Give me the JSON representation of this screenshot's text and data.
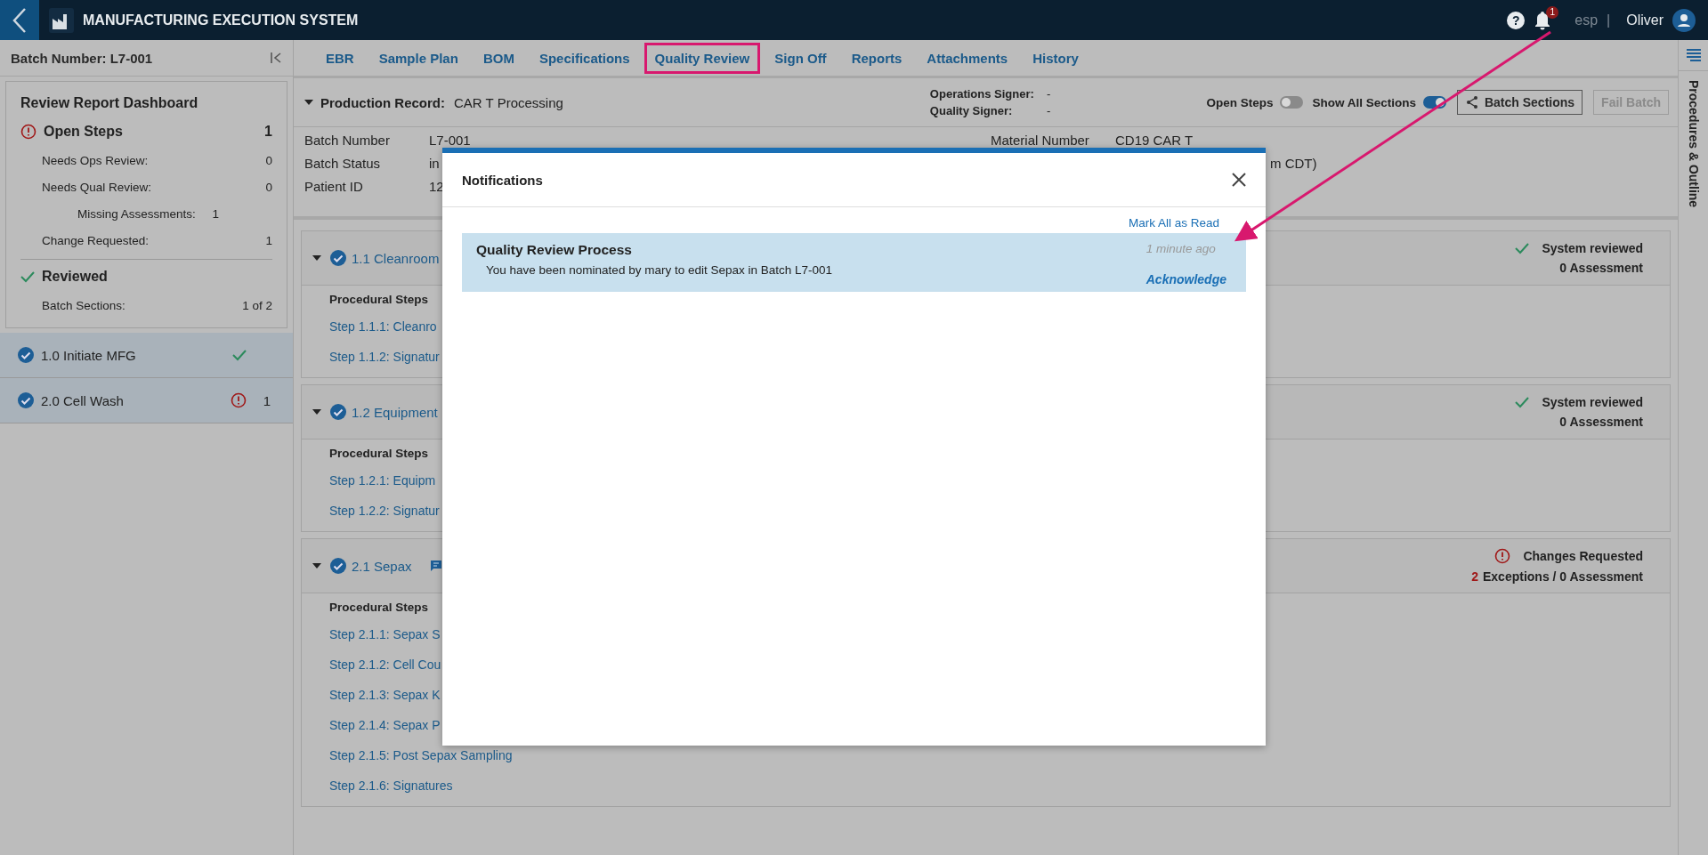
{
  "header": {
    "title": "MANUFACTURING EXECUTION SYSTEM",
    "help": "?",
    "notifications_badge": "1",
    "language": "esp",
    "separator": "|",
    "user": "Oliver"
  },
  "sidebar": {
    "batch_title": "Batch Number: L7-001",
    "dashboard": {
      "title": "Review Report Dashboard",
      "open_steps": {
        "label": "Open Steps",
        "value": "1"
      },
      "open_rows": [
        {
          "label": "Needs Ops Review:",
          "value": "0",
          "indented": false
        },
        {
          "label": "Needs Qual Review:",
          "value": "0",
          "indented": false
        },
        {
          "label": "Missing Assessments:",
          "value": "1",
          "indented": true
        },
        {
          "label": "Change Requested:",
          "value": "1",
          "indented": false
        }
      ],
      "reviewed": {
        "label": "Reviewed"
      },
      "reviewed_rows": [
        {
          "label": "Batch Sections:",
          "value": "1 of 2"
        }
      ]
    },
    "items": [
      {
        "label": "1.0 Initiate MFG",
        "kind": "ok"
      },
      {
        "label": "2.0 Cell Wash",
        "kind": "alert",
        "count": "1"
      }
    ]
  },
  "tabs": [
    {
      "label": "EBR",
      "selected": false
    },
    {
      "label": "Sample Plan",
      "selected": false
    },
    {
      "label": "BOM",
      "selected": false
    },
    {
      "label": "Specifications",
      "selected": false
    },
    {
      "label": "Quality Review",
      "selected": true
    },
    {
      "label": "Sign Off",
      "selected": false
    },
    {
      "label": "Reports",
      "selected": false
    },
    {
      "label": "Attachments",
      "selected": false
    },
    {
      "label": "History",
      "selected": false
    }
  ],
  "record": {
    "label": "Production Record:",
    "value": "CAR T Processing",
    "signers": [
      {
        "label": "Operations Signer:",
        "value": "-"
      },
      {
        "label": "Quality Signer:",
        "value": "-"
      }
    ],
    "toggles": [
      {
        "label": "Open Steps",
        "on": false
      },
      {
        "label": "Show All Sections",
        "on": true
      }
    ],
    "buttons": [
      {
        "label": "Batch Sections",
        "disabled": false
      },
      {
        "label": "Fail Batch",
        "disabled": true
      }
    ]
  },
  "info": [
    {
      "label": "Batch Number",
      "value": "L7-001",
      "right_label": "Material Number",
      "right_value": "CD19 CAR T"
    },
    {
      "label": "Batch Status",
      "value": "in",
      "right_value": "m CDT)"
    },
    {
      "label": "Patient ID",
      "value": "12"
    }
  ],
  "sections": [
    {
      "title": "1.1 Cleanroom",
      "kind": "reviewed",
      "status_text": "System reviewed",
      "assessment": "0 Assessment",
      "steps_title": "Procedural Steps",
      "steps": [
        "Step 1.1.1: Cleanro",
        "Step 1.1.2: Signatur"
      ]
    },
    {
      "title": "1.2 Equipment",
      "kind": "reviewed",
      "status_text": "System reviewed",
      "assessment": "0 Assessment",
      "steps_title": "Procedural Steps",
      "steps": [
        "Step 1.2.1: Equipm",
        "Step 1.2.2: Signatur"
      ]
    },
    {
      "title": "2.1 Sepax",
      "comment": true,
      "kind": "changes",
      "status_text": "Changes Requested",
      "exceptions": "2",
      "assessment": "Exceptions / 0 Assessment",
      "steps_title": "Procedural Steps",
      "steps": [
        "Step 2.1.1: Sepax S",
        "Step 2.1.2: Cell Cou",
        "Step 2.1.3: Sepax K",
        "Step 2.1.4: Sepax P",
        "Step 2.1.5: Post Sepax Sampling",
        "Step 2.1.6: Signatures"
      ]
    }
  ],
  "right_rail": {
    "label": "Procedures & Outline"
  },
  "modal": {
    "title": "Notifications",
    "mark_all": "Mark All as Read",
    "notifications": [
      {
        "title": "Quality Review Process",
        "time": "1 minute ago",
        "message": "You have been nominated by mary to edit Sepax in Batch L7-001",
        "action": "Acknowledge"
      }
    ]
  }
}
